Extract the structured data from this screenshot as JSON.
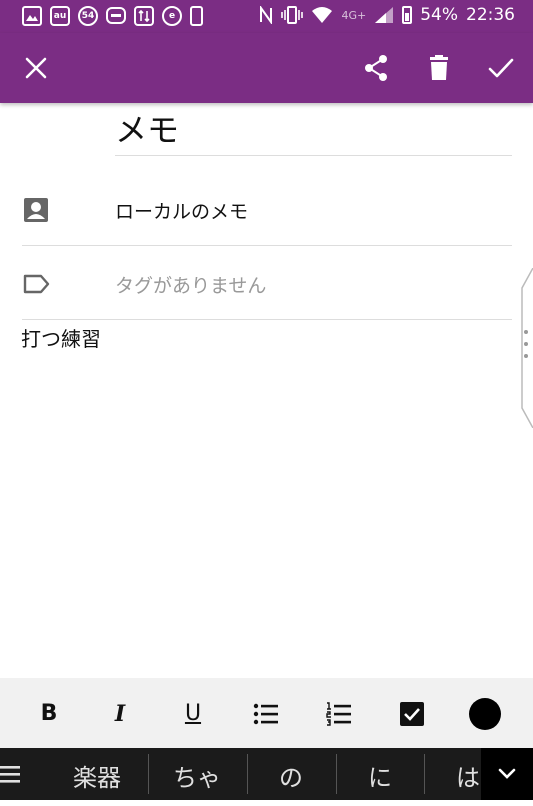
{
  "status_bar": {
    "battery": "54%",
    "time": "22:36",
    "network": "4G+",
    "notification_icons": [
      "gallery-icon",
      "au-icon",
      "badge-54-icon",
      "line-icon",
      "app-icon",
      "e-icon",
      "phone-icon"
    ],
    "badge_count": "54",
    "au_label": "au",
    "e_label": "e"
  },
  "app_bar": {
    "color": "#7b2d84",
    "actions": [
      "close-icon",
      "share-icon",
      "delete-icon",
      "check-icon"
    ]
  },
  "note": {
    "title": "メモ",
    "notebook": "ローカルのメモ",
    "tags_placeholder": "タグがありません",
    "body": "打つ練習"
  },
  "format_toolbar": {
    "bold": "B",
    "italic": "I",
    "underline": "U",
    "bg": "#f1f1f1"
  },
  "keyboard_suggestions": [
    "楽器",
    "ちゃ",
    "の",
    "に",
    "は"
  ]
}
